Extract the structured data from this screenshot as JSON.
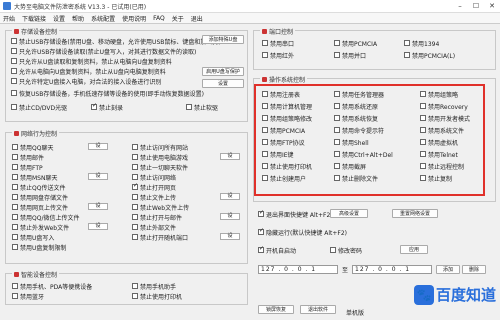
{
  "window": {
    "title": "大势至电脑文件防泄密系统 V13.3 - 已试用(已用)"
  },
  "menu": [
    "开始",
    "下载链接",
    "设置",
    "帮助",
    "系统配置",
    "使用说明",
    "FAQ",
    "关于",
    "退出"
  ],
  "storage": {
    "legend": "存储设备控制",
    "items": [
      {
        "label": "禁止USB存储设备(禁用U盘、移动硬盘，允许使用USB鼠标、键盘和加密狗)",
        "checked": false
      },
      {
        "label": "只允许USB存储设备读取(禁止U盘写入，对其进行数据文件的读取)",
        "checked": false
      },
      {
        "label": "只允许从U盘读取和复制资料，禁止从电脑向U盘复制资料",
        "checked": false
      },
      {
        "label": "允许从电脑向U盘复制资料，禁止从U盘向电脑复制资料",
        "checked": false
      },
      {
        "label": "只允许特定U盘接入电脑，对合法的接入设备进行识别",
        "checked": false
      },
      {
        "label": "恢复USB存储设备，手机低速存储等设备的使用(即手动恢复数据设置)",
        "checked": false
      },
      {
        "label": "禁止CD/DVD光驱",
        "checked": false
      },
      {
        "label": "禁止刻录",
        "checked": true
      },
      {
        "label": "禁止软驱",
        "checked": false
      }
    ],
    "buttons": [
      "添加特殊U盘",
      "启用U盘写保护",
      "设置"
    ]
  },
  "network": {
    "legend": "网络行为控制",
    "left": [
      "禁用QQ聊天",
      "禁用邮件",
      "禁用FTP",
      "禁用MSN聊天",
      "禁止QQ传送文件",
      "禁用网盘存储文件",
      "禁用网页上传文件",
      "禁用QQ/微信上传文件",
      "禁止外发Web文件",
      "禁用U盘写入",
      "禁用U盘复制限制"
    ],
    "right": [
      "禁止访问所有网站",
      "禁止使用电脑游戏",
      "禁止一切聊天软件",
      "禁止访问网络",
      "禁止打开网页",
      "禁止文件上传",
      "禁止Web文件上传",
      "禁止打开与邮件",
      "禁止外部文件",
      "禁止打开随机端口"
    ],
    "right_checked": [
      false,
      false,
      false,
      false,
      true,
      false,
      false,
      false,
      false,
      false
    ],
    "set_label": "设"
  },
  "mobile": {
    "legend": "智能设备控制",
    "items": [
      "禁用手机、PDA等便携设备",
      "禁用手机助手",
      "禁用蓝牙",
      "禁止使用打印机"
    ]
  },
  "ports": {
    "legend": "端口控制",
    "items": [
      "禁用串口",
      "禁用红外",
      "禁用1394",
      "禁用PCMCIA",
      "禁用并口",
      "禁用PCMCIA(L)",
      "禁用1394"
    ],
    "link": "禁用屏幕(禁止截屏)"
  },
  "os": {
    "legend": "操作系统控制",
    "items": [
      [
        "禁用注册表",
        "禁用任务管理器",
        "禁用组策略"
      ],
      [
        "禁用计算机管理",
        "禁用系统还原",
        "禁用Recovery"
      ],
      [
        "禁用组策略修改",
        "禁用系统恢复",
        "禁用开发者模式"
      ],
      [
        "禁用PCMCIA",
        "禁用命令提示符",
        "禁用系统文件"
      ],
      [
        "禁用FTP协议",
        "禁用Shell",
        "禁用虚拟机"
      ],
      [
        "禁用IE键",
        "禁用Ctrl+Alt+Del",
        "禁用Telnet"
      ],
      [
        "禁止使用打印机",
        "禁用截屏",
        "禁止远程控制"
      ],
      [
        "禁止创建用户",
        "禁止删除文件",
        "禁止复制"
      ]
    ]
  },
  "bottom": {
    "hotkey_label": "退出界面快捷键 Alt+F2",
    "btn1": "高级设置",
    "btn2": "重置网络设置",
    "startup_label": "开机自启动",
    "startup_hint": "隐藏运行(默认快捷键 Alt+F2)",
    "password_btn": "修改密码",
    "apply_btn": "应用",
    "ip_label1": "只控制",
    "ip_label2": "至",
    "ip_from": "127 . 0 . 0 . 1",
    "ip_to": "127 . 0 . 0 . 1",
    "add_btn": "添加",
    "remove_btn": "删除"
  },
  "status": {
    "a": "锁屏恢复",
    "b": "退出软件",
    "c": "单机版"
  },
  "watermark": {
    "text": "百度知道"
  }
}
